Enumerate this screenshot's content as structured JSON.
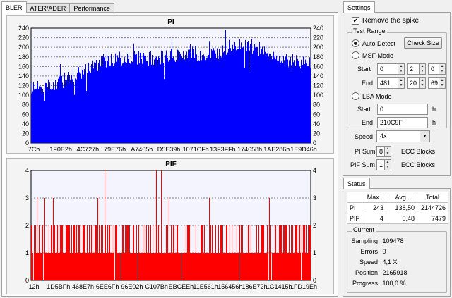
{
  "tabs": [
    "BLER",
    "ATER/ADER",
    "Performance"
  ],
  "active_tab": 0,
  "chart_data": [
    {
      "type": "bar",
      "title": "PI",
      "ylim": [
        0,
        240
      ],
      "yticks": [
        0,
        20,
        40,
        60,
        80,
        100,
        120,
        140,
        160,
        180,
        200,
        220,
        240
      ],
      "xtick_labels": [
        "7Ch",
        "1F0E2h",
        "4C727h",
        "79E76h",
        "A7465h",
        "D5E39h",
        "1071CFh",
        "13F3FFh",
        "174658h",
        "1AE286h",
        "1E9D46h"
      ],
      "color": "#0000ff",
      "background": "#f4f4ff",
      "grid": true,
      "profile": [
        [
          0.0,
          112
        ],
        [
          0.06,
          118
        ],
        [
          0.12,
          132
        ],
        [
          0.18,
          150
        ],
        [
          0.26,
          172
        ],
        [
          0.35,
          180
        ],
        [
          0.45,
          176
        ],
        [
          0.52,
          184
        ],
        [
          0.58,
          190
        ],
        [
          0.62,
          178
        ],
        [
          0.66,
          186
        ],
        [
          0.72,
          208
        ],
        [
          0.78,
          204
        ],
        [
          0.84,
          190
        ],
        [
          0.9,
          175
        ],
        [
          0.96,
          168
        ],
        [
          1.0,
          165
        ]
      ],
      "noise": 16,
      "max": 243
    },
    {
      "type": "bar",
      "title": "PIF",
      "ylim": [
        0,
        4
      ],
      "yticks": [
        0,
        1,
        2,
        3,
        4
      ],
      "xtick_labels": [
        "12h",
        "1D5BFh",
        "468E7h",
        "6EE6Fh",
        "96E02h",
        "C107Bh",
        "EBCEEh",
        "11E561h",
        "156456h",
        "186E72h",
        "1C1415h",
        "1FD19Eh"
      ],
      "color": "#ff0000",
      "background": "#f4f4ff",
      "grid": true,
      "max": 4
    }
  ],
  "settings": {
    "title": "Settings",
    "remove_spike_label": "Remove the spike",
    "remove_spike_checked": true,
    "test_range_title": "Test Range",
    "auto_detect_label": "Auto Detect",
    "check_size_label": "Check Size",
    "msf_mode_label": "MSF Mode",
    "start_label": "Start",
    "end_label": "End",
    "msf_start": [
      "0",
      "2",
      "0"
    ],
    "msf_end": [
      "481",
      "20",
      "69"
    ],
    "lba_mode_label": "LBA Mode",
    "lba_start": "0",
    "lba_end": "210C9F",
    "h_suffix": "h",
    "speed_label": "Speed",
    "speed_value": "4x",
    "pi_sum_label": "PI Sum",
    "pi_sum_value": "8",
    "pif_sum_label": "PIF Sum",
    "pif_sum_value": "1",
    "ecc_blocks_label": "ECC Blocks"
  },
  "status": {
    "title": "Status",
    "headers": [
      "Max.",
      "Avg.",
      "Total"
    ],
    "rows": [
      {
        "name": "PI",
        "max": "243",
        "avg": "138,50",
        "total": "2144726"
      },
      {
        "name": "PIF",
        "max": "4",
        "avg": "0,48",
        "total": "7479"
      }
    ],
    "current_title": "Current",
    "current": [
      {
        "label": "Sampling",
        "value": "109478"
      },
      {
        "label": "Errors",
        "value": "0"
      },
      {
        "label": "Speed",
        "value": "4,1  X"
      },
      {
        "label": "Position",
        "value": "2165918"
      },
      {
        "label": "Progress",
        "value": "100,0 %"
      }
    ]
  }
}
